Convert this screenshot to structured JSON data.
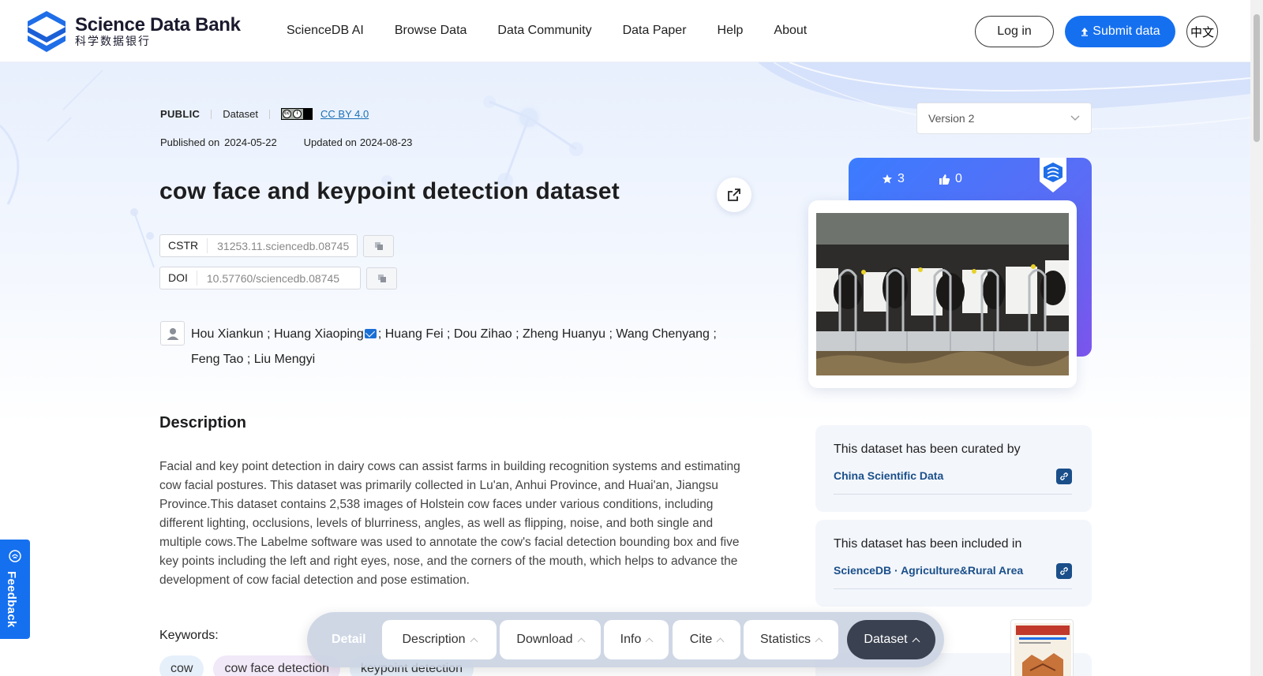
{
  "header": {
    "logo_en": "Science Data Bank",
    "logo_cn": "科学数据银行",
    "nav": [
      "ScienceDB AI",
      "Browse Data",
      "Data Community",
      "Data Paper",
      "Help",
      "About"
    ],
    "login_label": "Log in",
    "submit_label": "Submit data",
    "lang_label": "中文"
  },
  "dataset": {
    "access": "PUBLIC",
    "type": "Dataset",
    "license": "CC BY 4.0",
    "published_label": "Published on",
    "published_date": "2024-05-22",
    "updated_label": "Updated on",
    "updated_date": "2024-08-23",
    "title": "cow face and keypoint detection dataset",
    "cstr_label": "CSTR",
    "cstr_value": "31253.11.sciencedb.08745",
    "doi_label": "DOI",
    "doi_value": "10.57760/sciencedb.08745",
    "authors_part1": "Hou Xiankun ; Huang Xiaoping",
    "authors_part2": "; Huang Fei ; Dou Zihao ; Zheng Huanyu ; Wang Chenyang ;",
    "authors_part3": "Feng Tao ; Liu Mengyi"
  },
  "description": {
    "title": "Description",
    "text": "Facial and key point detection in dairy cows can assist farms in building recognition systems and estimating cow facial postures. This dataset was primarily collected in Lu'an, Anhui Province, and Huai'an, Jiangsu Province.This dataset contains 2,538 images of Holstein cow faces under various conditions, including different lighting, occlusions, levels of blurriness, angles, as well as flipping, noise, and both single and multiple cows.The Labelme software was used to annotate the cow's facial detection bounding box and five key points including the left and right eyes, nose, and the corners of the mouth, which helps to advance the development of cow facial detection and pose estimation.",
    "keywords_label": "Keywords:",
    "keywords": [
      "cow",
      "cow face detection",
      "keypoint detection"
    ]
  },
  "sidebar": {
    "version": "Version 2",
    "stars": "3",
    "likes": "0",
    "curated_label": "This dataset has been curated by",
    "curated_org": "China Scientific Data",
    "included_label": "This dataset has been included in",
    "included_org": "ScienceDB · Agriculture&Rural Area"
  },
  "feedback_label": "Feedback",
  "tabbar": {
    "detail": "Detail",
    "tabs": [
      "Description",
      "Download",
      "Info",
      "Cite",
      "Statistics",
      "Dataset"
    ],
    "active": "Dataset"
  },
  "colors": {
    "primary": "#1570ef",
    "org_link": "#1a4f8a",
    "tab_active": "#3a4150"
  }
}
